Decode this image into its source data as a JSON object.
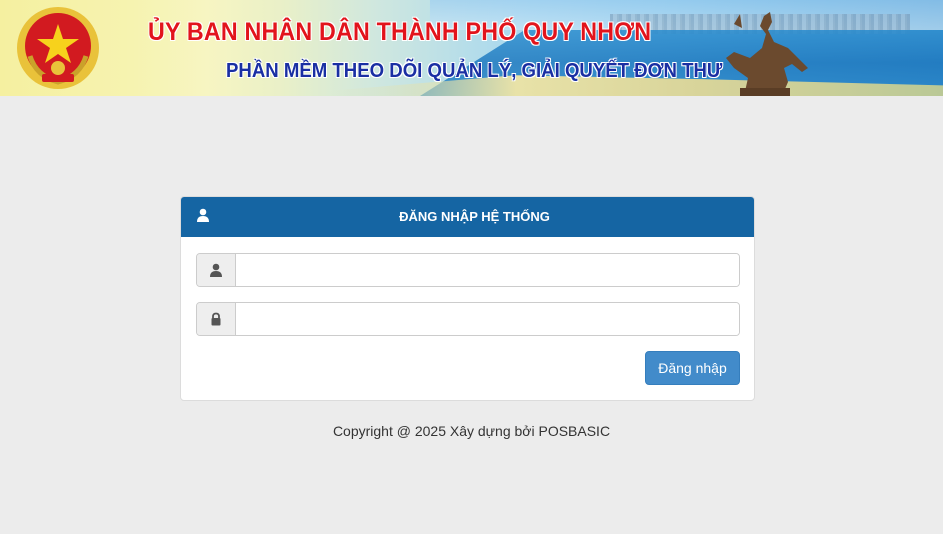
{
  "header": {
    "title_line1": "ỦY BAN NHÂN DÂN THÀNH PHỐ QUY NHƠN",
    "title_line2": "PHẦN MỀM THEO DÕI QUẢN LÝ, GIẢI QUYẾT ĐƠN THƯ",
    "emblem_icon": "vietnam-national-emblem",
    "statue_icon": "equestrian-statue",
    "colors": {
      "title_line1": "#e2141c",
      "title_line2": "#1a2fa3"
    }
  },
  "login": {
    "title": "ĐĂNG NHẬP HỆ THỐNG",
    "header_icon": "user-icon",
    "username": {
      "value": "",
      "placeholder": "",
      "icon": "user-icon"
    },
    "password": {
      "value": "",
      "placeholder": "",
      "icon": "lock-icon"
    },
    "submit_label": "Đăng nhập",
    "colors": {
      "header_bg": "#1565a3",
      "button_bg": "#428bca"
    }
  },
  "footer": {
    "copyright": "Copyright @ 2025 Xây dựng bởi POSBASIC"
  }
}
